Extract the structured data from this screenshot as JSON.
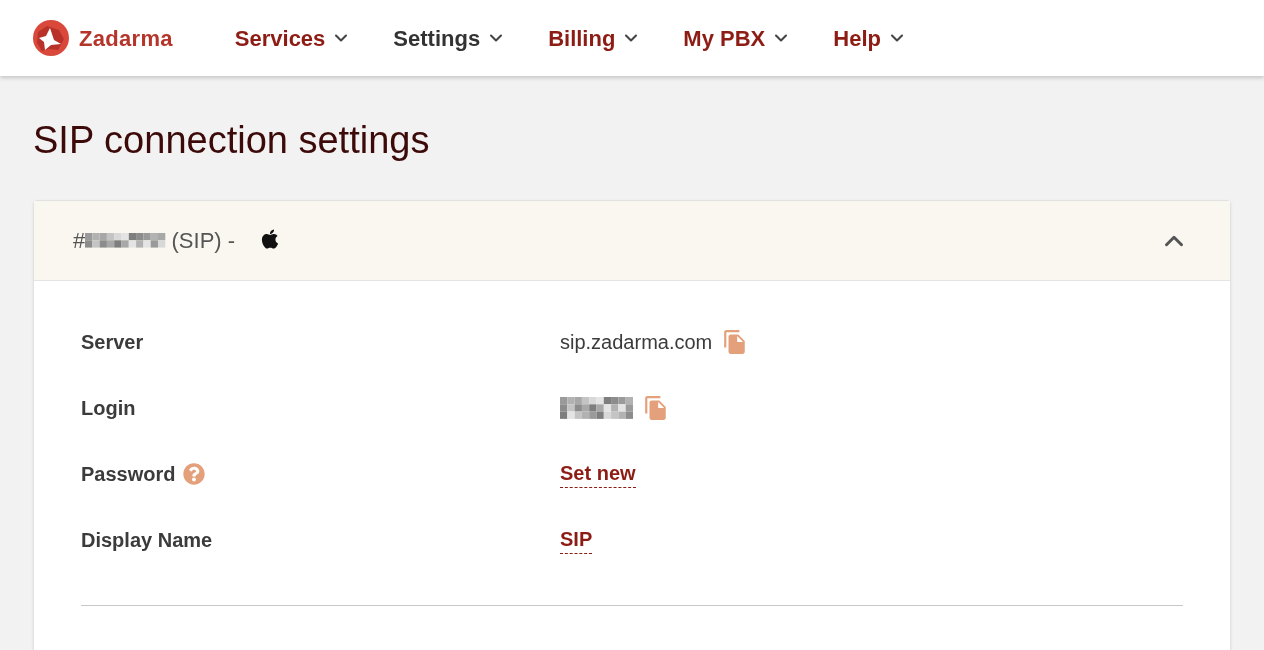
{
  "header": {
    "logo_text": "Zadarma",
    "nav": [
      {
        "label": "Services",
        "selected": false
      },
      {
        "label": "Settings",
        "selected": true
      },
      {
        "label": "Billing",
        "selected": false
      },
      {
        "label": "My PBX",
        "selected": false
      },
      {
        "label": "Help",
        "selected": false
      }
    ]
  },
  "page_title": "SIP connection settings",
  "sip_card": {
    "title_prefix": "#",
    "title_redacted": true,
    "title_suffix": "(SIP) -",
    "expanded": true,
    "fields": [
      {
        "kind": "text",
        "label": "Server",
        "value": "sip.zadarma.com",
        "copyable": true,
        "help": false
      },
      {
        "kind": "redacted",
        "label": "Login",
        "copyable": true,
        "help": false
      },
      {
        "kind": "link",
        "label": "Password",
        "value": "Set new",
        "copyable": false,
        "help": true
      },
      {
        "kind": "link",
        "label": "Display Name",
        "value": "SIP",
        "copyable": false,
        "help": false
      }
    ]
  }
}
